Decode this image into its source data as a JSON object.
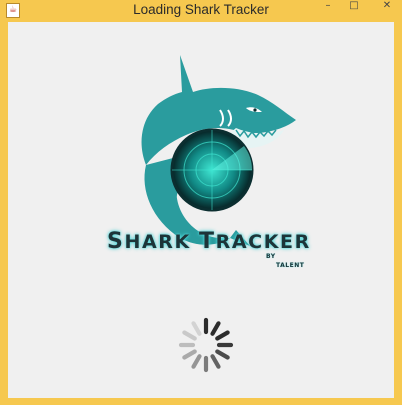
{
  "window": {
    "title": "Loading Shark Tracker",
    "app_icon": "java-icon",
    "buttons": {
      "minimize": "–",
      "maximize": "□",
      "close": "✕"
    }
  },
  "splash": {
    "brand_first": "S",
    "brand_rest_1": "HARK ",
    "brand_second": "T",
    "brand_rest_2": "RACKER",
    "by_text": "BY",
    "author_text": "TALENT",
    "logo_icon": "shark-radar-logo",
    "spinner_icon": "loading-spinner-icon"
  },
  "colors": {
    "titlebar": "#f6c84f",
    "client_bg": "#f0f0f0",
    "shark_teal": "#2a9c9e",
    "radar_dark": "#0b2e30",
    "radar_glow": "#38e0cf"
  }
}
